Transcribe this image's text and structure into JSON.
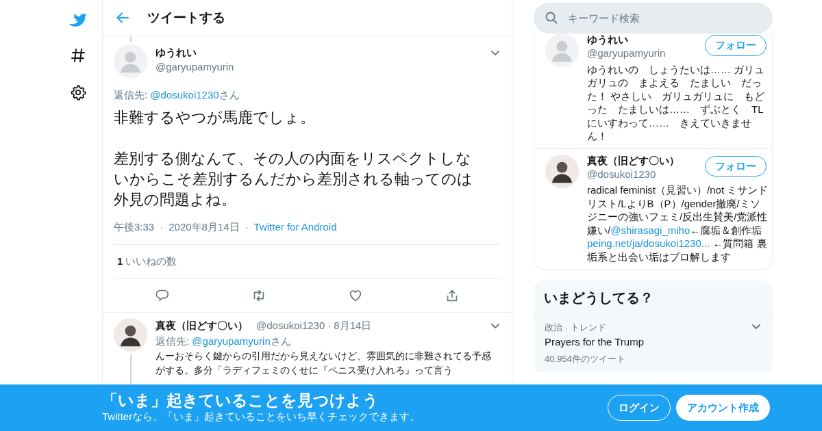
{
  "header": {
    "title": "ツイートする"
  },
  "tweet": {
    "name": "ゆうれい",
    "handle": "@garyupamyurin",
    "reply_label": "返信先: ",
    "reply_to": "@dosukoi1230",
    "reply_suffix": "さん",
    "paragraphs": [
      "非難するやつが馬鹿でしょ。",
      "差別する側なんて、その人の内面をリスペクトしないからこそ差別するんだから差別される軸ってのは外見の問題よね。"
    ],
    "meta": [
      {
        "kind": "text",
        "text": "午後3:33"
      },
      {
        "kind": "sep",
        "text": "·"
      },
      {
        "kind": "text",
        "text": "2020年8月14日"
      },
      {
        "kind": "sep",
        "text": "·"
      },
      {
        "kind": "link",
        "text": "Twitter for Android"
      }
    ],
    "likes_count": "1",
    "likes_label": "いいねの数"
  },
  "reply": {
    "name": "真夜（旧どす〇い）",
    "handle": "@dosukoi1230",
    "sep": "·",
    "date": "8月14日",
    "reply_label": "返信先: ",
    "reply_to": "@garyupamyurin",
    "reply_suffix": "さん",
    "text": "んーおそらく鍵からの引用だから見えないけど、雰囲気的に非難されてる予感がする。多分「ラディフェミのくせに『ペニス受け入れろ』って言う"
  },
  "search": {
    "placeholder": "キーワード検索"
  },
  "users": [
    {
      "name": "ゆうれい",
      "handle": "@garyupamyurin",
      "follow": "フォロー",
      "bio": [
        {
          "kind": "text",
          "text": "ゆうれいの　しょうたいは…… ガリュガリュの　まよえる　たましい　だった！ やさしい　ガリュガリュに　もどった　たましいは……　ずぶとく　TLにいすわって……　きえていきません！"
        }
      ]
    },
    {
      "name": "真夜（旧どす〇い）",
      "handle": "@dosukoi1230",
      "follow": "フォロー",
      "bio": [
        {
          "kind": "text",
          "text": "radical feminist（見習い）/not ミサンドリスト/LよりB（P）/gender撤廃/ミソジニーの強いフェミ/反出生賛美/党派性嫌い/"
        },
        {
          "kind": "link",
          "text": "@shirasagi_miho"
        },
        {
          "kind": "text",
          "text": "←腐垢＆創作垢 "
        },
        {
          "kind": "link",
          "text": "peing.net/ja/dosukoi1230..."
        },
        {
          "kind": "text",
          "text": " ←質問箱 裏垢系と出会い垢はブロ解します"
        }
      ]
    }
  ],
  "trends": {
    "title": "いまどうしてる？",
    "items": [
      {
        "category": "政治 · トレンド",
        "name": "Prayers for the Trump",
        "count": "40,954件のツイート"
      }
    ]
  },
  "banner": {
    "title": "「いま」起きていることを見つけよう",
    "subtitle": "Twitterなら、「いま」起きていることをいち早くチェックできます。",
    "login": "ログイン",
    "signup": "アカウント作成"
  }
}
